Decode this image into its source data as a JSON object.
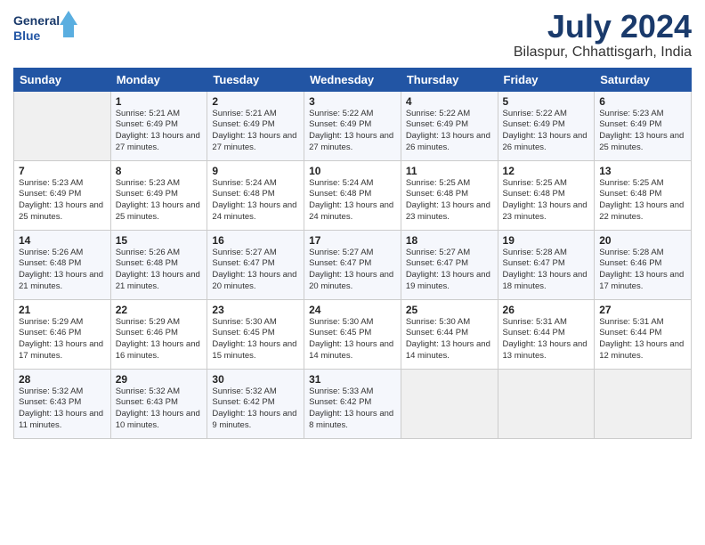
{
  "header": {
    "logo_line1": "General",
    "logo_line2": "Blue",
    "month": "July 2024",
    "location": "Bilaspur, Chhattisgarh, India"
  },
  "weekdays": [
    "Sunday",
    "Monday",
    "Tuesday",
    "Wednesday",
    "Thursday",
    "Friday",
    "Saturday"
  ],
  "weeks": [
    [
      {
        "day": "",
        "sunrise": "",
        "sunset": "",
        "daylight": ""
      },
      {
        "day": "1",
        "sunrise": "Sunrise: 5:21 AM",
        "sunset": "Sunset: 6:49 PM",
        "daylight": "Daylight: 13 hours and 27 minutes."
      },
      {
        "day": "2",
        "sunrise": "Sunrise: 5:21 AM",
        "sunset": "Sunset: 6:49 PM",
        "daylight": "Daylight: 13 hours and 27 minutes."
      },
      {
        "day": "3",
        "sunrise": "Sunrise: 5:22 AM",
        "sunset": "Sunset: 6:49 PM",
        "daylight": "Daylight: 13 hours and 27 minutes."
      },
      {
        "day": "4",
        "sunrise": "Sunrise: 5:22 AM",
        "sunset": "Sunset: 6:49 PM",
        "daylight": "Daylight: 13 hours and 26 minutes."
      },
      {
        "day": "5",
        "sunrise": "Sunrise: 5:22 AM",
        "sunset": "Sunset: 6:49 PM",
        "daylight": "Daylight: 13 hours and 26 minutes."
      },
      {
        "day": "6",
        "sunrise": "Sunrise: 5:23 AM",
        "sunset": "Sunset: 6:49 PM",
        "daylight": "Daylight: 13 hours and 25 minutes."
      }
    ],
    [
      {
        "day": "7",
        "sunrise": "Sunrise: 5:23 AM",
        "sunset": "Sunset: 6:49 PM",
        "daylight": "Daylight: 13 hours and 25 minutes."
      },
      {
        "day": "8",
        "sunrise": "Sunrise: 5:23 AM",
        "sunset": "Sunset: 6:49 PM",
        "daylight": "Daylight: 13 hours and 25 minutes."
      },
      {
        "day": "9",
        "sunrise": "Sunrise: 5:24 AM",
        "sunset": "Sunset: 6:48 PM",
        "daylight": "Daylight: 13 hours and 24 minutes."
      },
      {
        "day": "10",
        "sunrise": "Sunrise: 5:24 AM",
        "sunset": "Sunset: 6:48 PM",
        "daylight": "Daylight: 13 hours and 24 minutes."
      },
      {
        "day": "11",
        "sunrise": "Sunrise: 5:25 AM",
        "sunset": "Sunset: 6:48 PM",
        "daylight": "Daylight: 13 hours and 23 minutes."
      },
      {
        "day": "12",
        "sunrise": "Sunrise: 5:25 AM",
        "sunset": "Sunset: 6:48 PM",
        "daylight": "Daylight: 13 hours and 23 minutes."
      },
      {
        "day": "13",
        "sunrise": "Sunrise: 5:25 AM",
        "sunset": "Sunset: 6:48 PM",
        "daylight": "Daylight: 13 hours and 22 minutes."
      }
    ],
    [
      {
        "day": "14",
        "sunrise": "Sunrise: 5:26 AM",
        "sunset": "Sunset: 6:48 PM",
        "daylight": "Daylight: 13 hours and 21 minutes."
      },
      {
        "day": "15",
        "sunrise": "Sunrise: 5:26 AM",
        "sunset": "Sunset: 6:48 PM",
        "daylight": "Daylight: 13 hours and 21 minutes."
      },
      {
        "day": "16",
        "sunrise": "Sunrise: 5:27 AM",
        "sunset": "Sunset: 6:47 PM",
        "daylight": "Daylight: 13 hours and 20 minutes."
      },
      {
        "day": "17",
        "sunrise": "Sunrise: 5:27 AM",
        "sunset": "Sunset: 6:47 PM",
        "daylight": "Daylight: 13 hours and 20 minutes."
      },
      {
        "day": "18",
        "sunrise": "Sunrise: 5:27 AM",
        "sunset": "Sunset: 6:47 PM",
        "daylight": "Daylight: 13 hours and 19 minutes."
      },
      {
        "day": "19",
        "sunrise": "Sunrise: 5:28 AM",
        "sunset": "Sunset: 6:47 PM",
        "daylight": "Daylight: 13 hours and 18 minutes."
      },
      {
        "day": "20",
        "sunrise": "Sunrise: 5:28 AM",
        "sunset": "Sunset: 6:46 PM",
        "daylight": "Daylight: 13 hours and 17 minutes."
      }
    ],
    [
      {
        "day": "21",
        "sunrise": "Sunrise: 5:29 AM",
        "sunset": "Sunset: 6:46 PM",
        "daylight": "Daylight: 13 hours and 17 minutes."
      },
      {
        "day": "22",
        "sunrise": "Sunrise: 5:29 AM",
        "sunset": "Sunset: 6:46 PM",
        "daylight": "Daylight: 13 hours and 16 minutes."
      },
      {
        "day": "23",
        "sunrise": "Sunrise: 5:30 AM",
        "sunset": "Sunset: 6:45 PM",
        "daylight": "Daylight: 13 hours and 15 minutes."
      },
      {
        "day": "24",
        "sunrise": "Sunrise: 5:30 AM",
        "sunset": "Sunset: 6:45 PM",
        "daylight": "Daylight: 13 hours and 14 minutes."
      },
      {
        "day": "25",
        "sunrise": "Sunrise: 5:30 AM",
        "sunset": "Sunset: 6:44 PM",
        "daylight": "Daylight: 13 hours and 14 minutes."
      },
      {
        "day": "26",
        "sunrise": "Sunrise: 5:31 AM",
        "sunset": "Sunset: 6:44 PM",
        "daylight": "Daylight: 13 hours and 13 minutes."
      },
      {
        "day": "27",
        "sunrise": "Sunrise: 5:31 AM",
        "sunset": "Sunset: 6:44 PM",
        "daylight": "Daylight: 13 hours and 12 minutes."
      }
    ],
    [
      {
        "day": "28",
        "sunrise": "Sunrise: 5:32 AM",
        "sunset": "Sunset: 6:43 PM",
        "daylight": "Daylight: 13 hours and 11 minutes."
      },
      {
        "day": "29",
        "sunrise": "Sunrise: 5:32 AM",
        "sunset": "Sunset: 6:43 PM",
        "daylight": "Daylight: 13 hours and 10 minutes."
      },
      {
        "day": "30",
        "sunrise": "Sunrise: 5:32 AM",
        "sunset": "Sunset: 6:42 PM",
        "daylight": "Daylight: 13 hours and 9 minutes."
      },
      {
        "day": "31",
        "sunrise": "Sunrise: 5:33 AM",
        "sunset": "Sunset: 6:42 PM",
        "daylight": "Daylight: 13 hours and 8 minutes."
      },
      {
        "day": "",
        "sunrise": "",
        "sunset": "",
        "daylight": ""
      },
      {
        "day": "",
        "sunrise": "",
        "sunset": "",
        "daylight": ""
      },
      {
        "day": "",
        "sunrise": "",
        "sunset": "",
        "daylight": ""
      }
    ]
  ]
}
